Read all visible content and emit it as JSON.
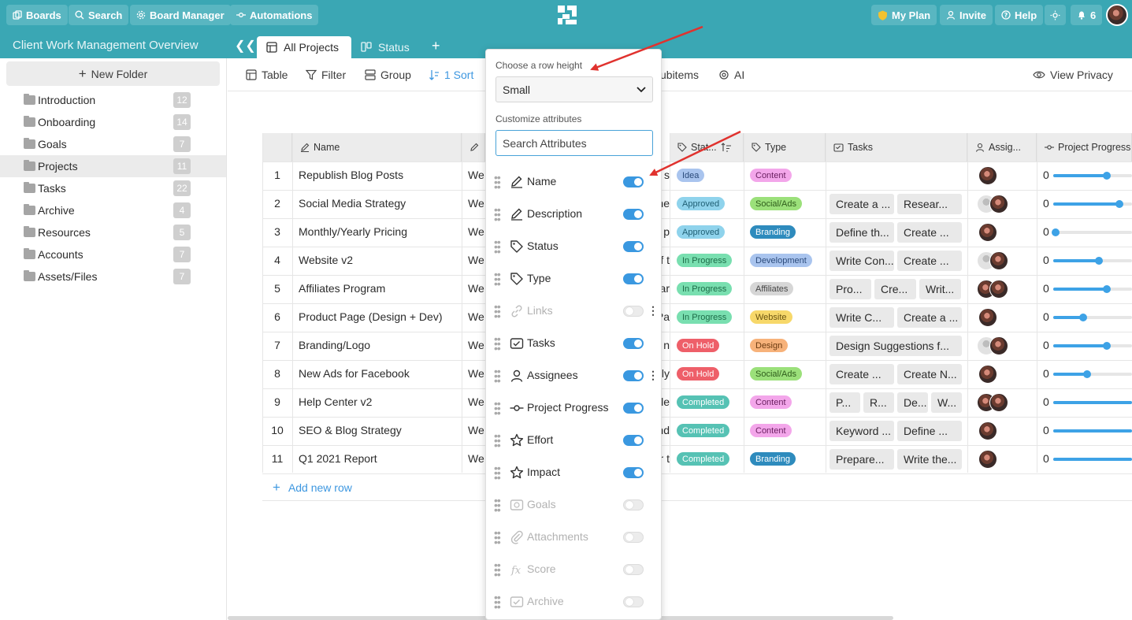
{
  "topbar": {
    "boards": "Boards",
    "search": "Search",
    "board_manager": "Board Manager",
    "automations": "Automations",
    "my_plan": "My Plan",
    "invite": "Invite",
    "help": "Help",
    "notifications_count": "6"
  },
  "workspace": {
    "title": "Client Work Management Overview",
    "tabs": [
      {
        "label": "All Projects",
        "active": true
      },
      {
        "label": "Status",
        "active": false
      }
    ]
  },
  "sidebar": {
    "new_folder": "New Folder",
    "folders": [
      {
        "name": "Introduction",
        "count": "12",
        "selected": false
      },
      {
        "name": "Onboarding",
        "count": "14",
        "selected": false
      },
      {
        "name": "Goals",
        "count": "7",
        "selected": false
      },
      {
        "name": "Projects",
        "count": "11",
        "selected": true
      },
      {
        "name": "Tasks",
        "count": "22",
        "selected": false
      },
      {
        "name": "Archive",
        "count": "4",
        "selected": false
      },
      {
        "name": "Resources",
        "count": "5",
        "selected": false
      },
      {
        "name": "Accounts",
        "count": "7",
        "selected": false
      },
      {
        "name": "Assets/Files",
        "count": "7",
        "selected": false
      }
    ]
  },
  "toolbar": {
    "table": "Table",
    "filter": "Filter",
    "group": "Group",
    "sort": "1 Sort",
    "subitems": "ubitems",
    "ai": "AI",
    "view_privacy": "View Privacy"
  },
  "table": {
    "headers": {
      "name": "Name",
      "status": "Stat...",
      "type": "Type",
      "tasks": "Tasks",
      "assignees": "Assig...",
      "progress": "Project Progress"
    },
    "rows": [
      {
        "num": "1",
        "name": "Republish Blog Posts",
        "desc": "We",
        "frag": "s",
        "status": "Idea",
        "type": "Content",
        "tasks": [],
        "progress_label": "0",
        "progress": 0.68,
        "avatars": [
          "photo"
        ]
      },
      {
        "num": "2",
        "name": "Social Media Strategy",
        "desc": "We",
        "frag": "ne",
        "status": "Approved",
        "type": "Social/Ads",
        "tasks": [
          "Create a ...",
          "Resear..."
        ],
        "progress_label": "0",
        "progress": 0.84,
        "avatars": [
          "gray",
          "photo"
        ]
      },
      {
        "num": "3",
        "name": "Monthly/Yearly Pricing",
        "desc": "We",
        "frag": "p",
        "status": "Approved",
        "type": "Branding",
        "tasks": [
          "Define th...",
          "Create ..."
        ],
        "progress_label": "0",
        "progress": 0.03,
        "avatars": [
          "photo"
        ]
      },
      {
        "num": "4",
        "name": "Website v2",
        "desc": "We",
        "frag": "f t",
        "status": "In Progress",
        "type": "Development",
        "tasks": [
          "Write Con...",
          "Create ..."
        ],
        "progress_label": "0",
        "progress": 0.58,
        "avatars": [
          "gray",
          "photo"
        ]
      },
      {
        "num": "5",
        "name": "Affiliates Program",
        "desc": "We",
        "frag": "ar",
        "status": "In Progress",
        "type": "Affiliates",
        "tasks": [
          "Pro...",
          "Cre...",
          "Writ..."
        ],
        "progress_label": "0",
        "progress": 0.68,
        "avatars": [
          "photo",
          "photo"
        ]
      },
      {
        "num": "6",
        "name": "Product Page (Design + Dev)",
        "desc": "We",
        "frag": "Pa",
        "status": "In Progress",
        "type": "Website",
        "tasks": [
          "Write C...",
          "Create a ..."
        ],
        "progress_label": "0",
        "progress": 0.38,
        "avatars": [
          "photo"
        ]
      },
      {
        "num": "7",
        "name": "Branding/Logo",
        "desc": "We",
        "frag": "n",
        "status": "On Hold",
        "type": "Design",
        "tasks": [
          "Design Suggestions f..."
        ],
        "progress_label": "0",
        "progress": 0.68,
        "avatars": [
          "gray",
          "photo"
        ]
      },
      {
        "num": "8",
        "name": "New Ads for Facebook",
        "desc": "We",
        "frag": "ly",
        "status": "On Hold",
        "type": "Social/Ads",
        "tasks": [
          "Create ...",
          "Create N..."
        ],
        "progress_label": "0",
        "progress": 0.43,
        "avatars": [
          "photo"
        ]
      },
      {
        "num": "9",
        "name": "Help Center v2",
        "desc": "We",
        "frag": "le",
        "status": "Completed",
        "type": "Content",
        "tasks": [
          "P...",
          "R...",
          "De...",
          "W..."
        ],
        "progress_label": "0",
        "progress": 1.0,
        "avatars": [
          "photo",
          "photo"
        ]
      },
      {
        "num": "10",
        "name": "SEO & Blog Strategy",
        "desc": "We",
        "frag": "nd",
        "status": "Completed",
        "type": "Content",
        "tasks": [
          "Keyword ...",
          "Define ..."
        ],
        "progress_label": "0",
        "progress": 1.0,
        "avatars": [
          "photo"
        ]
      },
      {
        "num": "11",
        "name": "Q1 2021 Report",
        "desc": "We",
        "frag": "r t",
        "status": "Completed",
        "type": "Branding",
        "tasks": [
          "Prepare...",
          "Write the..."
        ],
        "progress_label": "0",
        "progress": 1.0,
        "avatars": [
          "photo"
        ]
      }
    ],
    "add_row": "Add new row"
  },
  "status_colors": {
    "Idea": {
      "bg": "#a9c4ee",
      "fg": "#2b4a7a"
    },
    "Approved": {
      "bg": "#8fd3ec",
      "fg": "#1f5f74"
    },
    "In Progress": {
      "bg": "#79dfb0",
      "fg": "#1c6b47"
    },
    "On Hold": {
      "bg": "#ee5f69",
      "fg": "#ffffff"
    },
    "Completed": {
      "bg": "#56c2b4",
      "fg": "#ffffff"
    }
  },
  "type_colors": {
    "Content": {
      "bg": "#f3a6ea",
      "fg": "#6a1f60"
    },
    "Social/Ads": {
      "bg": "#9be07a",
      "fg": "#2f5d1c"
    },
    "Branding": {
      "bg": "#2e8bbd",
      "fg": "#ffffff"
    },
    "Development": {
      "bg": "#a9c4ee",
      "fg": "#2b4a7a"
    },
    "Affiliates": {
      "bg": "#d6d6d6",
      "fg": "#444444"
    },
    "Website": {
      "bg": "#f7d86a",
      "fg": "#6a5310"
    },
    "Design": {
      "bg": "#f7b27a",
      "fg": "#6a3a10"
    }
  },
  "popup": {
    "row_height_label": "Choose a row height",
    "row_height_value": "Small",
    "customize_label": "Customize attributes",
    "search_placeholder": "Search Attributes",
    "attributes": [
      {
        "label": "Name",
        "icon": "pencil-icon",
        "on": true
      },
      {
        "label": "Description",
        "icon": "pencil-icon",
        "on": true
      },
      {
        "label": "Status",
        "icon": "tag-icon",
        "on": true
      },
      {
        "label": "Type",
        "icon": "tag-icon",
        "on": true
      },
      {
        "label": "Links",
        "icon": "link-icon",
        "on": false
      },
      {
        "label": "Tasks",
        "icon": "tasks-icon",
        "on": true
      },
      {
        "label": "Assignees",
        "icon": "user-icon",
        "on": true
      },
      {
        "label": "Project Progress",
        "icon": "progress-icon",
        "on": true
      },
      {
        "label": "Effort",
        "icon": "star-icon",
        "on": true
      },
      {
        "label": "Impact",
        "icon": "star-icon",
        "on": true
      },
      {
        "label": "Goals",
        "icon": "goals-icon",
        "on": false
      },
      {
        "label": "Attachments",
        "icon": "paperclip-icon",
        "on": false
      },
      {
        "label": "Score",
        "icon": "formula-icon",
        "on": false
      },
      {
        "label": "Archive",
        "icon": "archive-icon",
        "on": false
      }
    ]
  },
  "colors": {
    "topbar": "#3aa7b4",
    "accent": "#3d97e0",
    "annotation_arrow": "#e0322e"
  }
}
